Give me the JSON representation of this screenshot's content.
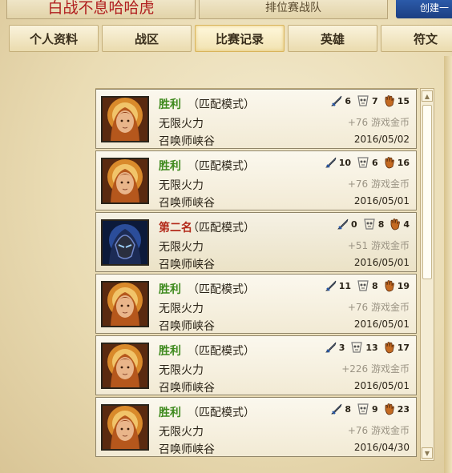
{
  "header": {
    "player_name": "白战不息哈哈虎",
    "ranked_team_tab": "排位赛战队",
    "create_button": "创建一"
  },
  "tabs": [
    {
      "label": "个人资料"
    },
    {
      "label": "战区"
    },
    {
      "label": "比赛记录",
      "active": true
    },
    {
      "label": "英雄"
    },
    {
      "label": "符文"
    }
  ],
  "matches": [
    {
      "result": "胜利",
      "result_type": "win",
      "mode": "（匹配模式）",
      "map": "无限火力",
      "place": "召唤师峡谷",
      "kills": "6",
      "deaths": "7",
      "assists": "15",
      "gold": "+76 游戏金币",
      "date": "2016/05/02",
      "champion": "leona-icon"
    },
    {
      "result": "胜利",
      "result_type": "win",
      "mode": "（匹配模式）",
      "map": "无限火力",
      "place": "召唤师峡谷",
      "kills": "10",
      "deaths": "6",
      "assists": "16",
      "gold": "+76 游戏金币",
      "date": "2016/05/01",
      "champion": "leona-icon"
    },
    {
      "result": "第二名",
      "result_type": "second",
      "mode": "（匹配模式）",
      "map": "无限火力",
      "place": "召唤师峡谷",
      "kills": "0",
      "deaths": "8",
      "assists": "4",
      "gold": "+51 游戏金币",
      "date": "2016/05/01",
      "champion": "shen-icon"
    },
    {
      "result": "胜利",
      "result_type": "win",
      "mode": "（匹配模式）",
      "map": "无限火力",
      "place": "召唤师峡谷",
      "kills": "11",
      "deaths": "8",
      "assists": "19",
      "gold": "+76 游戏金币",
      "date": "2016/05/01",
      "champion": "leona-icon"
    },
    {
      "result": "胜利",
      "result_type": "win",
      "mode": "（匹配模式）",
      "map": "无限火力",
      "place": "召唤师峡谷",
      "kills": "3",
      "deaths": "13",
      "assists": "17",
      "gold": "+226 游戏金币",
      "date": "2016/05/01",
      "champion": "leona-icon"
    },
    {
      "result": "胜利",
      "result_type": "win",
      "mode": "（匹配模式）",
      "map": "无限火力",
      "place": "召唤师峡谷",
      "kills": "8",
      "deaths": "9",
      "assists": "23",
      "gold": "+76 游戏金币",
      "date": "2016/04/30",
      "champion": "leona-icon"
    }
  ],
  "colors": {
    "win": "#3f8a1e",
    "second": "#b32a1a",
    "accent_blue": "#2e5fb0"
  }
}
